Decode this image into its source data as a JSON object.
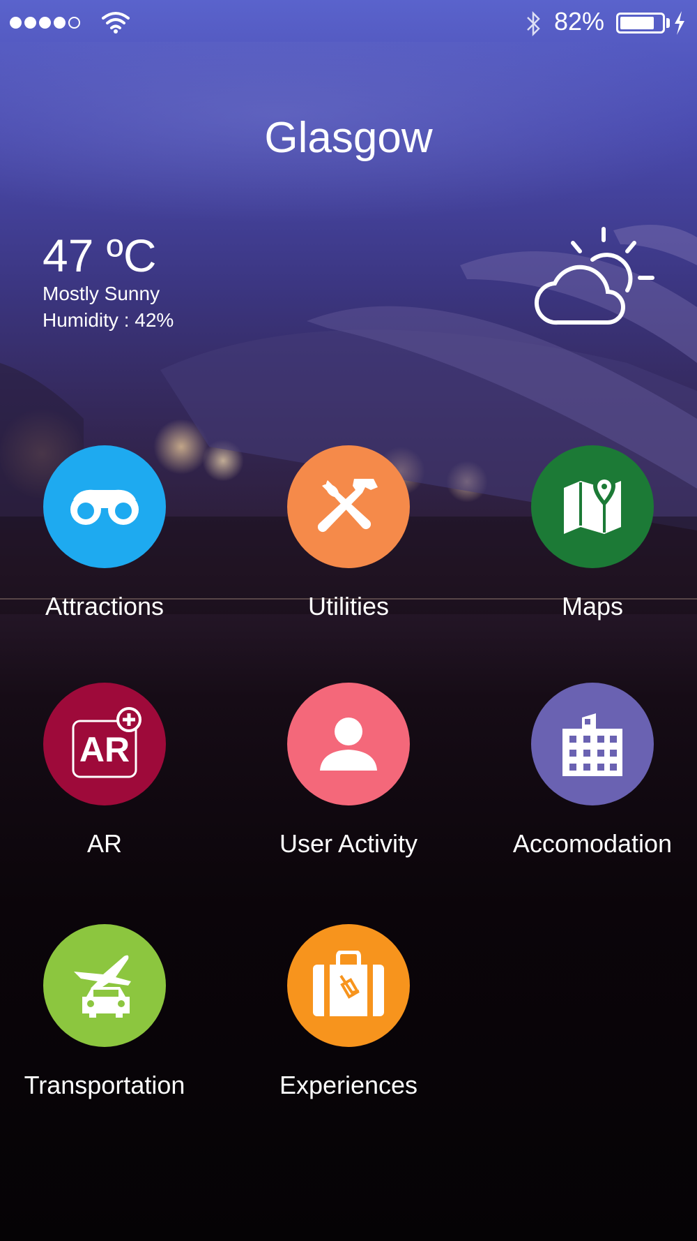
{
  "status_bar": {
    "signal_bars_filled": 4,
    "signal_bars_total": 5,
    "battery_text": "82%",
    "battery_level": 0.82,
    "icons": [
      "wifi-icon",
      "bluetooth-icon",
      "battery-icon",
      "charging-bolt-icon"
    ]
  },
  "city": "Glasgow",
  "weather": {
    "temperature": "47 ºC",
    "condition": "Mostly Sunny",
    "humidity": "Humidity : 42%",
    "icon": "partly-sunny-icon"
  },
  "menu": [
    {
      "label": "Attractions",
      "icon": "binoculars-icon",
      "color": "#1eaaf0"
    },
    {
      "label": "Utilities",
      "icon": "tools-icon",
      "color": "#f58a4a"
    },
    {
      "label": "Maps",
      "icon": "map-pin-icon",
      "color": "#1c7a36"
    },
    {
      "label": "AR",
      "icon": "ar-plus-icon",
      "color": "#9e0a3a"
    },
    {
      "label": "User Activity",
      "icon": "user-icon",
      "color": "#f4687a"
    },
    {
      "label": "Accomodation",
      "icon": "building-icon",
      "color": "#6a62b2"
    },
    {
      "label": "Transportation",
      "icon": "plane-car-icon",
      "color": "#8cc63f"
    },
    {
      "label": "Experiences",
      "icon": "suitcase-icon",
      "color": "#f7941d"
    }
  ]
}
